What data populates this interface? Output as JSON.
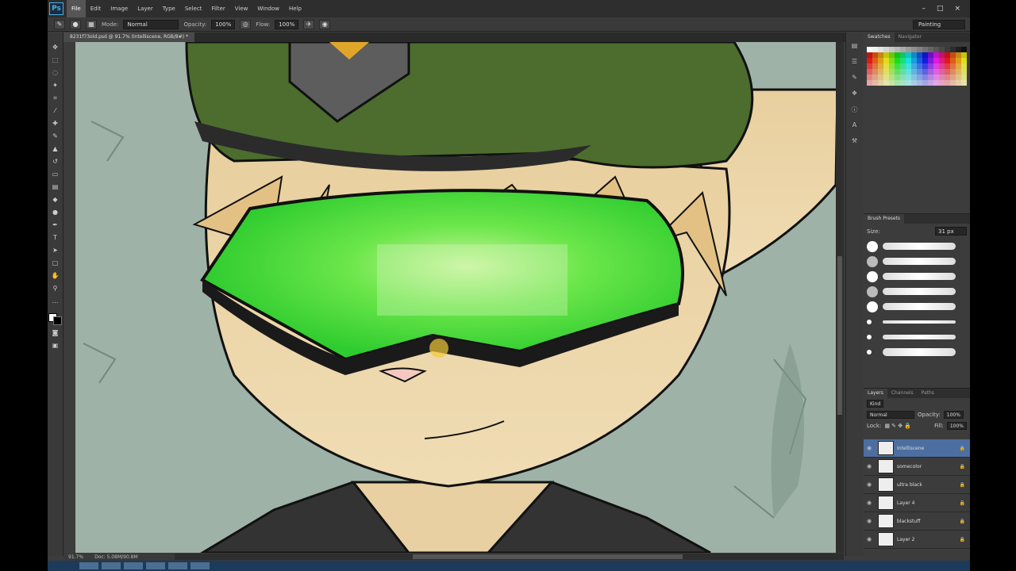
{
  "app": {
    "logo": "Ps"
  },
  "menu": [
    "File",
    "Edit",
    "Image",
    "Layer",
    "Type",
    "Select",
    "Filter",
    "View",
    "Window",
    "Help"
  ],
  "window_controls": [
    "–",
    "□",
    "×"
  ],
  "options_bar": {
    "mode_label": "Mode:",
    "mode_value": "Normal",
    "opacity_label": "Opacity:",
    "opacity_value": "100%",
    "flow_label": "Flow:",
    "flow_value": "100%",
    "workspace": "Painting"
  },
  "document_tab": "8231f73old.psd @ 91.7% (Intelliscene, RGB/8#) *",
  "status": {
    "zoom": "91.7%",
    "doc": "Doc: 5.08M/90.8M"
  },
  "panels": {
    "swatches_tab": "Swatches",
    "navigator_tab": "Navigator",
    "brush_presets_title": "Brush Presets",
    "size_label": "Size:",
    "size_value": "31 px",
    "layers_tabs": [
      "Layers",
      "Channels",
      "Paths"
    ],
    "kind_label": "Kind",
    "blend_mode": "Normal",
    "opacity_label": "Opacity:",
    "opacity_value": "100%",
    "lock_label": "Lock:",
    "fill_label": "Fill:",
    "fill_value": "100%"
  },
  "layers": [
    {
      "name": "Intelliscene",
      "selected": true
    },
    {
      "name": "somecolor",
      "selected": false
    },
    {
      "name": "ultra black",
      "selected": false
    },
    {
      "name": "Layer 4",
      "selected": false
    },
    {
      "name": "blackstuff",
      "selected": false
    },
    {
      "name": "Layer 2",
      "selected": false
    }
  ],
  "colors": {
    "hat": "#4a6b2c",
    "visor": "#45e044",
    "fur": "#e8d0a2",
    "background": "#9fb1a6"
  }
}
